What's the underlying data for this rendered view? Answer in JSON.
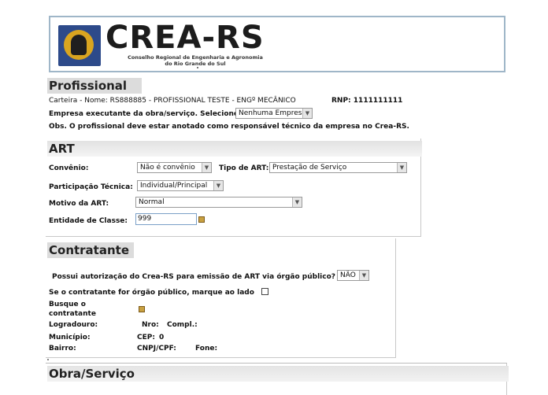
{
  "header": {
    "logo_title": "CREA-RS",
    "logo_subtitle_line1": "Conselho Regional de Engenharia e Agronomia",
    "logo_subtitle_line2": "do Rio Grande do Sul"
  },
  "profissional": {
    "title": "Profissional",
    "carteira_line": "Carteira - Nome:  RS888885  -  PROFISSIONAL TESTE - ENGº MECÂNICO",
    "rnp_line": "RNP: 1111111111",
    "empresa_label": "Empresa executante da obra/serviço. Selecione:",
    "empresa_value": "Nenhuma Empresa",
    "obs": "Obs. O profissional deve estar anotado como responsável técnico da empresa no Crea-RS."
  },
  "art": {
    "title": "ART",
    "convenio_label": "Convênio:",
    "convenio_value": "Não é convênio",
    "tipo_label": "Tipo de ART:",
    "tipo_value": "Prestação de Serviço",
    "participacao_label": "Participação Técnica:",
    "participacao_value": "Individual/Principal",
    "motivo_label": "Motivo da ART:",
    "motivo_value": "Normal",
    "entidade_label": "Entidade de Classe:",
    "entidade_value": "999"
  },
  "contratante": {
    "title": "Contratante",
    "autorizacao_label": "Possui autorização do Crea-RS para emissão de ART via órgão público?",
    "autorizacao_value": "NÃO",
    "orgao_label": "Se o contratante for órgão público, marque ao lado",
    "busque_line1": "Busque o",
    "busque_line2": "contratante",
    "logradouro_label": "Logradouro:",
    "nro_label": "Nro:",
    "compl_label": "Compl.:",
    "municipio_label": "Município:",
    "cep_label": "CEP:",
    "cep_value": "0",
    "bairro_label": "Bairro:",
    "cnpj_label": "CNPJ/CPF:",
    "fone_label": "Fone:"
  },
  "obra": {
    "title": "Obra/Serviço"
  }
}
